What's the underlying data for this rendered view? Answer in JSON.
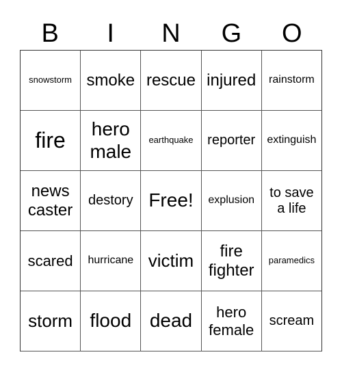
{
  "header": [
    "B",
    "I",
    "N",
    "G",
    "O"
  ],
  "rows": [
    [
      {
        "text": "snowstorm",
        "size": "s13"
      },
      {
        "text": "smoke",
        "size": "s24"
      },
      {
        "text": "rescue",
        "size": "s24"
      },
      {
        "text": "injured",
        "size": "s24"
      },
      {
        "text": "rainstorm",
        "size": "s16"
      }
    ],
    [
      {
        "text": "fire",
        "size": "s32"
      },
      {
        "text": "hero\nmale",
        "size": "s28"
      },
      {
        "text": "earthquake",
        "size": "s13"
      },
      {
        "text": "reporter",
        "size": "s20"
      },
      {
        "text": "extinguish",
        "size": "s16"
      }
    ],
    [
      {
        "text": "news\ncaster",
        "size": "s24"
      },
      {
        "text": "destory",
        "size": "s20"
      },
      {
        "text": "Free!",
        "size": "s28"
      },
      {
        "text": "explusion",
        "size": "s16"
      },
      {
        "text": "to save\na life",
        "size": "s20"
      }
    ],
    [
      {
        "text": "scared",
        "size": "s22"
      },
      {
        "text": "hurricane",
        "size": "s16"
      },
      {
        "text": "victim",
        "size": "s26"
      },
      {
        "text": "fire\nfighter",
        "size": "s24"
      },
      {
        "text": "paramedics",
        "size": "s13"
      }
    ],
    [
      {
        "text": "storm",
        "size": "s26"
      },
      {
        "text": "flood",
        "size": "s28"
      },
      {
        "text": "dead",
        "size": "s28"
      },
      {
        "text": "hero\nfemale",
        "size": "s22"
      },
      {
        "text": "scream",
        "size": "s20"
      }
    ]
  ]
}
